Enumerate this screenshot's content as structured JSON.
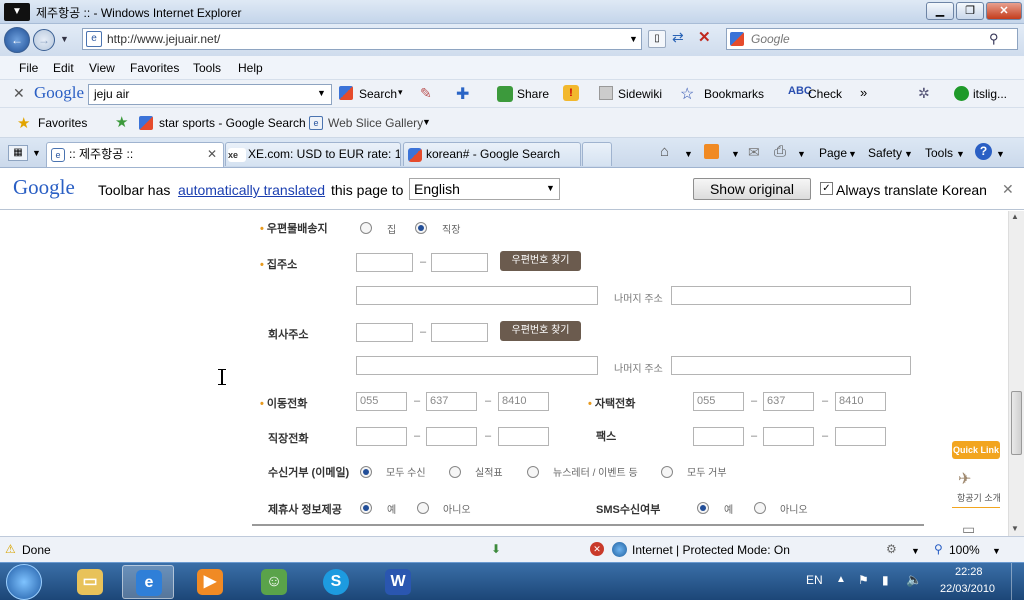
{
  "window": {
    "title": "제주항공 :: - Windows Internet Explorer"
  },
  "address": {
    "url": "http://www.jejuair.net/",
    "search_placeholder": "Google"
  },
  "menu": [
    "File",
    "Edit",
    "View",
    "Favorites",
    "Tools",
    "Help"
  ],
  "google_toolbar": {
    "logo": "Google",
    "query": "jeju air",
    "search": "Search",
    "share": "Share",
    "sidewiki": "Sidewiki",
    "bookmarks": "Bookmarks",
    "check": "Check",
    "account": "itslig..."
  },
  "favorites_bar": {
    "favorites": "Favorites",
    "link1": "star sports - Google Search",
    "link2": "Web Slice Gallery"
  },
  "tabs": [
    {
      "label": ":: 제주항공 ::"
    },
    {
      "label": "XE.com: USD to EUR rate: 1..."
    },
    {
      "label": "korean# - Google Search"
    }
  ],
  "command_bar": {
    "page": "Page",
    "safety": "Safety",
    "tools": "Tools"
  },
  "translate_bar": {
    "logo": "Google",
    "text_before": "Toolbar has",
    "link": "automatically translated",
    "text_after": "this page to",
    "language": "English",
    "show_original": "Show original",
    "always": "Always translate Korean"
  },
  "form": {
    "mail_label": "우편물배송지",
    "mail_opt1": "집",
    "mail_opt2": "직장",
    "home_label": "집주소",
    "zip_btn": "우편번호 찾기",
    "rest_addr": "나머지 주소",
    "company_label": "회사주소",
    "mobile_label": "이동전화",
    "mobile_vals": [
      "055",
      "637",
      "8410"
    ],
    "home_phone_label": "자택전화",
    "home_phone_vals": [
      "055",
      "637",
      "8410"
    ],
    "work_phone_label": "직장전화",
    "fax_label": "팩스",
    "optout_label": "수신거부 (이메일)",
    "optout_opts": [
      "모두 수신",
      "실적표",
      "뉴스레터 / 이벤트 등",
      "모두 거부"
    ],
    "partner_label": "제휴사 정보제공",
    "yes": "예",
    "no": "아니오",
    "sms_label": "SMS수신여부"
  },
  "quicklink": {
    "title": "Quick Link",
    "item": "항공기 소개"
  },
  "status": {
    "done": "Done",
    "zone": "Internet | Protected Mode: On",
    "zoom": "100%"
  },
  "taskbar": {
    "lang": "EN",
    "time": "22:28",
    "date": "22/03/2010"
  }
}
